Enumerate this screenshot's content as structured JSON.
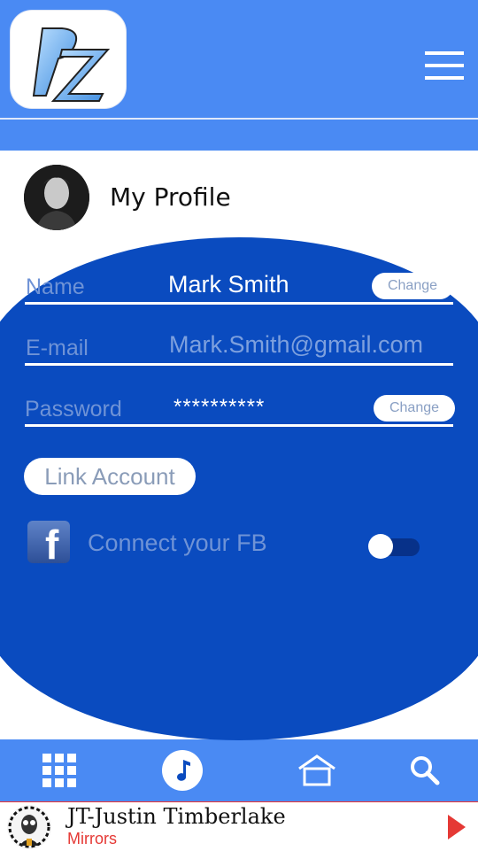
{
  "app": {
    "logo_alt": "BZ logo",
    "menu_icon": "hamburger-menu-icon"
  },
  "profile": {
    "title": "My Profile"
  },
  "fields": {
    "name_label": "Name",
    "name_value": "Mark Smith",
    "email_label": "E-mail",
    "email_value": "Mark.Smith@gmail.com",
    "password_label": "Password",
    "password_value": "**********",
    "change_label": "Change"
  },
  "link_account": {
    "label": "Link Account"
  },
  "facebook": {
    "text": "Connect your FB",
    "toggle_on": false
  },
  "nav": {
    "items": [
      {
        "icon": "grid-icon"
      },
      {
        "icon": "music-note-icon",
        "active": true
      },
      {
        "icon": "home-icon"
      },
      {
        "icon": "search-icon"
      }
    ]
  },
  "player": {
    "artist": "JT-Justin Timberlake",
    "song": "Mirrors"
  },
  "colors": {
    "header_blue": "#4a8af3",
    "panel_blue": "#0a4bbf",
    "accent_red": "#e53935"
  }
}
